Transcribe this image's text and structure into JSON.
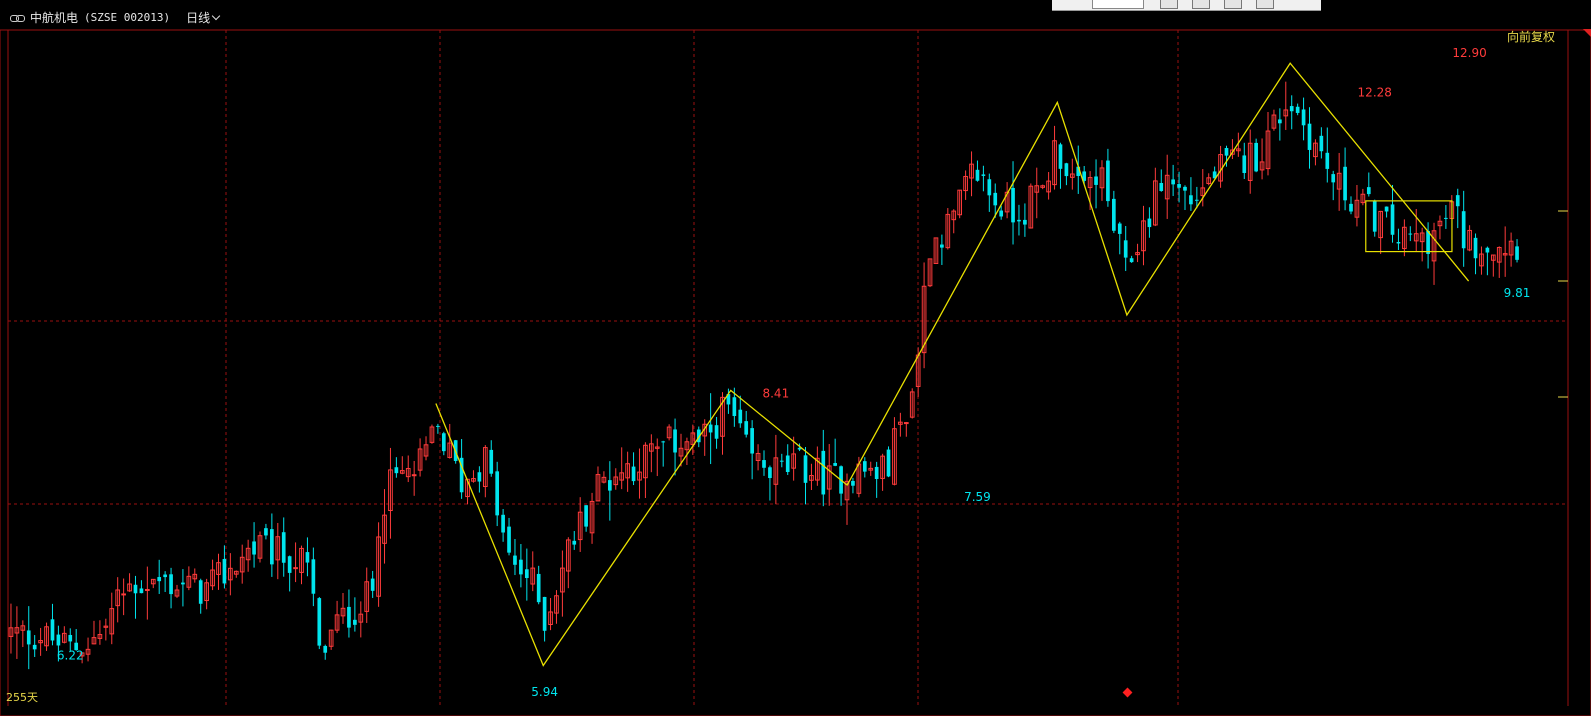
{
  "header": {
    "stock_name": "中航机电",
    "stock_code": "(SZSE 002013)",
    "period_label": "日线",
    "adjust_label": "向前复权",
    "days_label": "255天"
  },
  "colors": {
    "up": "#ff3b3b",
    "down": "#00e5ee",
    "zigzag": "#e8e000",
    "grid": "#9a1010",
    "high_label": "#ff3b3b",
    "low_label": "#00e5ee"
  },
  "chart_data": {
    "type": "candlestick",
    "period": "daily",
    "count": 255,
    "price_range": [
      5.94,
      12.9
    ],
    "visible_y_range": [
      5.75,
      13.45
    ],
    "scale": "log",
    "grid": true,
    "annotations": [
      {
        "type": "low",
        "index": 10,
        "value": 6.22
      },
      {
        "type": "low",
        "index": 90,
        "value": 5.94
      },
      {
        "type": "high",
        "index": 129,
        "value": 8.41
      },
      {
        "type": "low",
        "index": 163,
        "value": 7.59
      },
      {
        "type": "high",
        "index": 230,
        "value": 12.28
      },
      {
        "type": "high",
        "index": 246,
        "value": 12.9
      },
      {
        "type": "low",
        "index": 254,
        "value": 9.81
      }
    ],
    "zigzag": [
      {
        "index": 129,
        "value": 8.41
      },
      {
        "index": 150,
        "value": 6.05
      },
      {
        "index": 200,
        "value": 8.55
      },
      {
        "index": 163,
        "value": 7.59
      },
      {
        "index": 230,
        "value": 12.28
      },
      {
        "index": 235,
        "value": 9.4
      },
      {
        "index": 246,
        "value": 12.9
      },
      {
        "index": 254,
        "value": 9.81
      }
    ],
    "zigzag_x": [
      {
        "t": 0.283,
        "value": 8.41
      },
      {
        "t": 0.354,
        "value": 6.05
      },
      {
        "t": 0.478,
        "value": 8.55
      },
      {
        "t": 0.555,
        "value": 7.59
      },
      {
        "t": 0.694,
        "value": 12.28
      },
      {
        "t": 0.74,
        "value": 9.4
      },
      {
        "t": 0.848,
        "value": 12.9
      },
      {
        "t": 0.966,
        "value": 9.81
      }
    ],
    "consolidation_box": {
      "t_from": 0.898,
      "t_to": 0.955,
      "high": 10.85,
      "low": 10.18
    },
    "anchors": [
      {
        "t": 0.0,
        "value": 6.3
      },
      {
        "t": 0.02,
        "value": 6.28
      },
      {
        "t": 0.04,
        "value": 6.18
      },
      {
        "t": 0.06,
        "value": 6.28
      },
      {
        "t": 0.07,
        "value": 6.55
      },
      {
        "t": 0.08,
        "value": 6.7
      },
      {
        "t": 0.1,
        "value": 6.72
      },
      {
        "t": 0.13,
        "value": 6.65
      },
      {
        "t": 0.145,
        "value": 6.82
      },
      {
        "t": 0.16,
        "value": 7.02
      },
      {
        "t": 0.18,
        "value": 6.95
      },
      {
        "t": 0.195,
        "value": 6.88
      },
      {
        "t": 0.2,
        "value": 6.65
      },
      {
        "t": 0.205,
        "value": 6.1
      },
      {
        "t": 0.215,
        "value": 6.35
      },
      {
        "t": 0.23,
        "value": 6.52
      },
      {
        "t": 0.24,
        "value": 6.62
      },
      {
        "t": 0.245,
        "value": 7.4
      },
      {
        "t": 0.255,
        "value": 7.65
      },
      {
        "t": 0.27,
        "value": 7.72
      },
      {
        "t": 0.283,
        "value": 8.15
      },
      {
        "t": 0.3,
        "value": 7.6
      },
      {
        "t": 0.315,
        "value": 7.85
      },
      {
        "t": 0.33,
        "value": 6.9
      },
      {
        "t": 0.345,
        "value": 6.75
      },
      {
        "t": 0.355,
        "value": 6.4
      },
      {
        "t": 0.37,
        "value": 7.0
      },
      {
        "t": 0.39,
        "value": 7.6
      },
      {
        "t": 0.42,
        "value": 7.85
      },
      {
        "t": 0.445,
        "value": 8.05
      },
      {
        "t": 0.46,
        "value": 8.0
      },
      {
        "t": 0.475,
        "value": 8.4
      },
      {
        "t": 0.49,
        "value": 7.85
      },
      {
        "t": 0.51,
        "value": 7.72
      },
      {
        "t": 0.525,
        "value": 7.78
      },
      {
        "t": 0.545,
        "value": 7.62
      },
      {
        "t": 0.555,
        "value": 7.72
      },
      {
        "t": 0.58,
        "value": 7.72
      },
      {
        "t": 0.6,
        "value": 8.6
      },
      {
        "t": 0.61,
        "value": 10.3
      },
      {
        "t": 0.625,
        "value": 10.55
      },
      {
        "t": 0.64,
        "value": 11.3
      },
      {
        "t": 0.655,
        "value": 10.8
      },
      {
        "t": 0.67,
        "value": 10.7
      },
      {
        "t": 0.685,
        "value": 11.0
      },
      {
        "t": 0.694,
        "value": 11.65
      },
      {
        "t": 0.71,
        "value": 10.9
      },
      {
        "t": 0.722,
        "value": 11.3
      },
      {
        "t": 0.74,
        "value": 9.9
      },
      {
        "t": 0.752,
        "value": 10.5
      },
      {
        "t": 0.765,
        "value": 11.2
      },
      {
        "t": 0.785,
        "value": 10.85
      },
      {
        "t": 0.8,
        "value": 11.25
      },
      {
        "t": 0.815,
        "value": 11.4
      },
      {
        "t": 0.83,
        "value": 11.55
      },
      {
        "t": 0.848,
        "value": 12.35
      },
      {
        "t": 0.86,
        "value": 11.9
      },
      {
        "t": 0.88,
        "value": 11.05
      },
      {
        "t": 0.9,
        "value": 10.75
      },
      {
        "t": 0.925,
        "value": 10.3
      },
      {
        "t": 0.945,
        "value": 10.4
      },
      {
        "t": 0.958,
        "value": 10.75
      },
      {
        "t": 0.966,
        "value": 10.3
      }
    ]
  }
}
